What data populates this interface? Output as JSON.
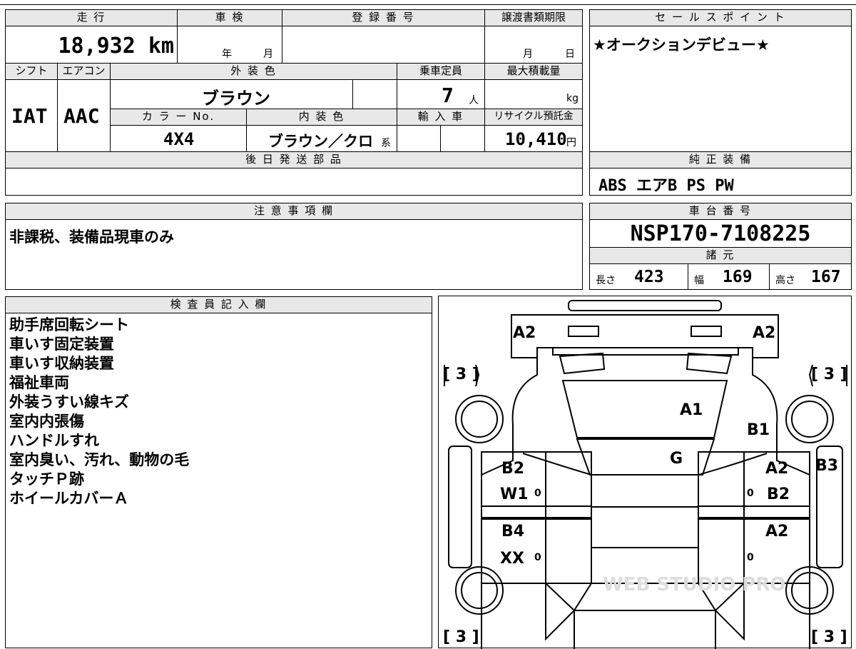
{
  "left_table": {
    "headers": {
      "mileage": "走 行",
      "inspection": "車 検",
      "registration_no": "登 録 番 号",
      "transfer_deadline": "譲渡書類期限",
      "shift": "シフト",
      "aircon": "エアコン",
      "exterior_color": "外 装 色",
      "capacity": "乗車定員",
      "max_load": "最大積載量",
      "color_no": "カ ラ ー No.",
      "interior_color": "内 装 色",
      "import": "輸 入 車",
      "recycle_fee": "リサイクル預託金",
      "later_parts": "後 日 発 送 部 品"
    },
    "values": {
      "mileage": "18,932 km",
      "inspection_year": "年",
      "inspection_month": "月",
      "transfer_month": "月",
      "transfer_day": "日",
      "shift": "IAT",
      "aircon": "AAC",
      "exterior_color": "ブラウン",
      "capacity": "7",
      "capacity_unit": "人",
      "max_load_unit": "kg",
      "color_no": "4X4",
      "interior_color": "ブラウン／クロ",
      "interior_suffix": "系",
      "recycle_fee": "10,410",
      "recycle_unit": "円"
    }
  },
  "sales_point": {
    "header": "セ ー ル ス ポ イ ン ト",
    "text": "★オークションデビュー★"
  },
  "factory_equipment": {
    "header": "純 正 装 備",
    "text": "ABS エアB PS PW"
  },
  "notes": {
    "header": "注 意 事 項 欄",
    "text": "非課税、装備品現車のみ"
  },
  "chassis": {
    "header": "車 台 番 号",
    "number": "NSP170-7108225",
    "spec_header": "諸 元",
    "length_label": "長さ",
    "length": "423",
    "width_label": "幅",
    "width": "169",
    "height_label": "高さ",
    "height": "167"
  },
  "inspector": {
    "header": "検 査 員 記 入 欄",
    "lines": [
      "助手席回転シート",
      "車いす固定装置",
      "車いす収納装置",
      "福祉車両",
      "外装うすい線キズ",
      "室内内張傷",
      "ハンドルすれ",
      "室内臭い、汚れ、動物の毛",
      "タッチＰ跡",
      "ホイールカバーＡ"
    ]
  },
  "diagram": {
    "marks": {
      "front_left": "A2",
      "front_right": "A2",
      "hood": "A1",
      "front_right_fender": "B1",
      "windshield": "G",
      "left_front_door_1": "B2",
      "left_front_door_2": "W1",
      "left_rear_door_1": "B4",
      "left_rear_door_2": "XX",
      "right_front_door_1": "A2",
      "right_front_door_2": "B2",
      "right_rear_door": "A2",
      "right_side_mirror": "B3",
      "tire_fl": "[ 3 ]",
      "tire_fr": "[ 3 ]",
      "tire_rl": "[ 3 ]",
      "tire_rr": "[ 3 ]",
      "zero": "0"
    },
    "watermark": "WEB STUDIO PRO"
  }
}
